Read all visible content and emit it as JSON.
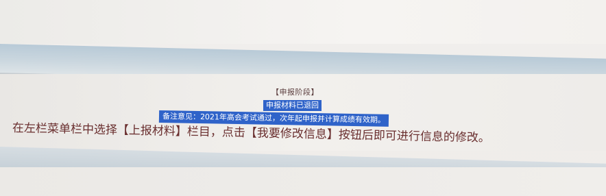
{
  "stage": {
    "label": "【申报阶段】"
  },
  "status": {
    "text": "申报材料已退回"
  },
  "note": {
    "text": "备注意见：2021年高会考试通过，次年起申报并计算成绩有效期。"
  },
  "instruction": {
    "text": "在左栏菜单栏中选择【上报材料】栏目，点击【我要修改信息】按钮后即可进行信息的修改。"
  },
  "colors": {
    "highlight": "#2f63c9",
    "instruction_text": "#6a2f2f",
    "header_bar": "#c3d0da"
  }
}
